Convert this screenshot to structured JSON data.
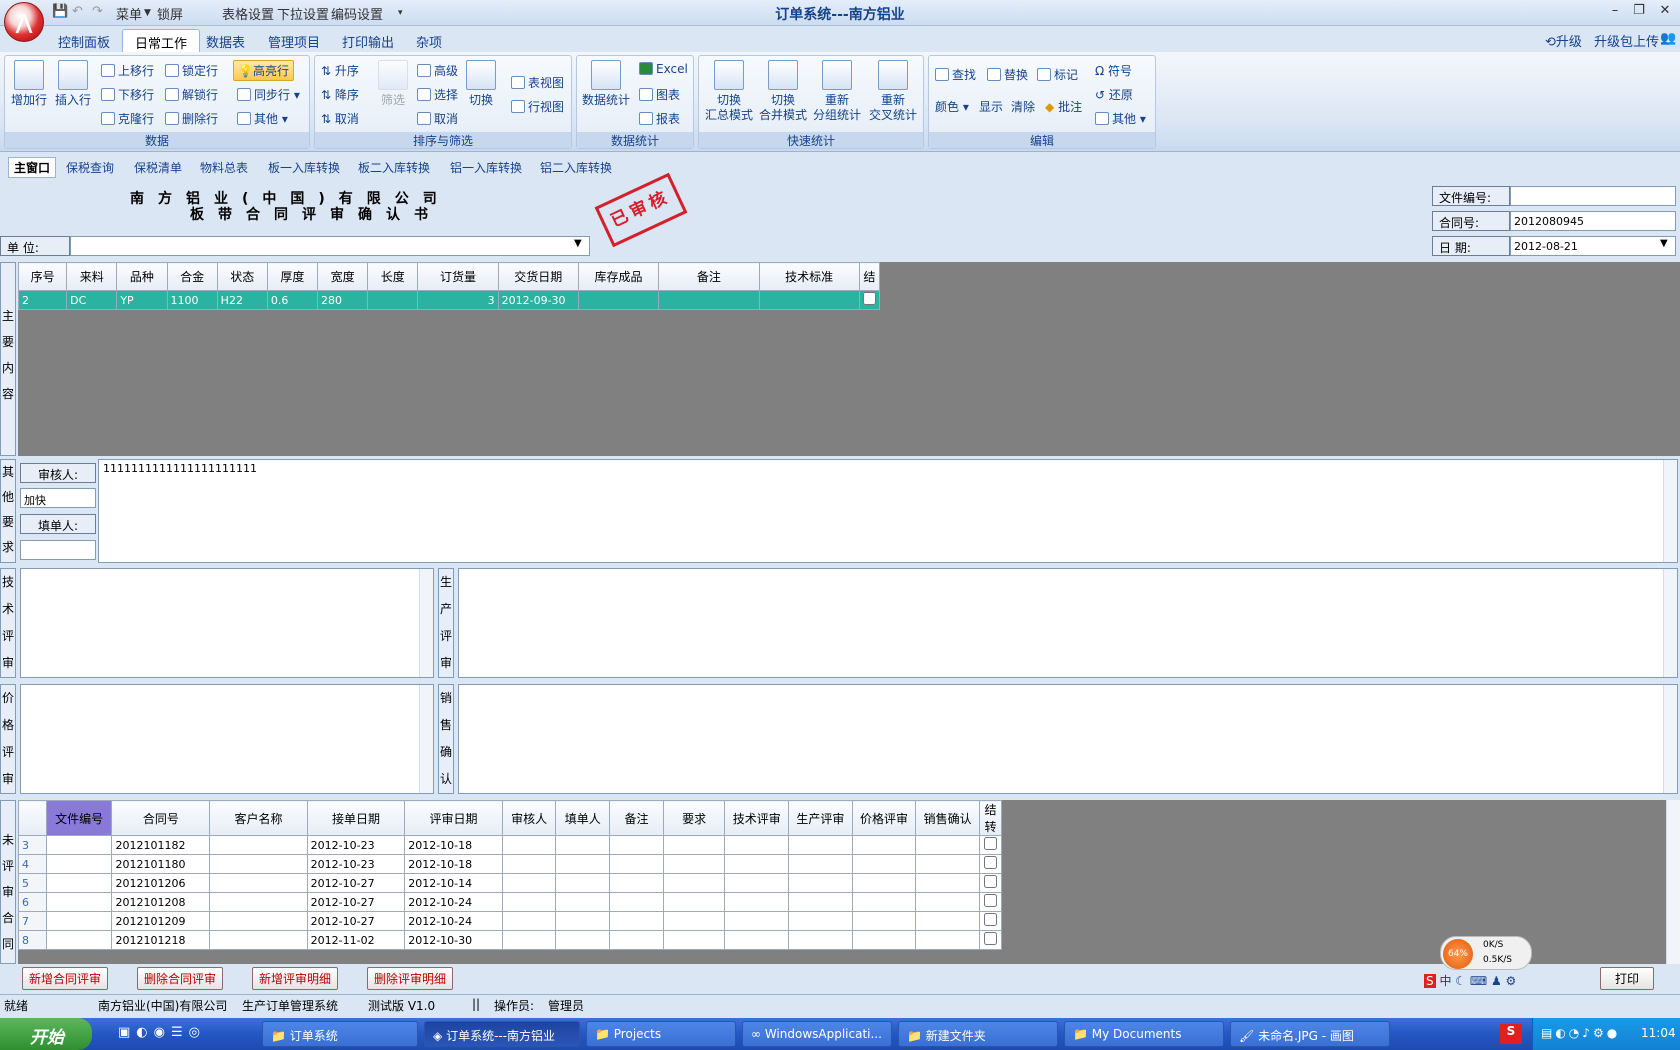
{
  "window": {
    "title": "订单系统---南方铝业",
    "min": "–",
    "max": "❐",
    "close": "✕"
  },
  "quickaccess": {
    "menu": "菜单",
    "lock": "锁屏",
    "table_settings": "表格设置",
    "dropdown_settings": "下拉设置",
    "encoding_settings": "编码设置"
  },
  "ribbon_tabs": [
    "控制面板",
    "日常工作",
    "数据表",
    "管理项目",
    "打印输出",
    "杂项"
  ],
  "upgrade": {
    "upgrade": "升级",
    "upload": "升级包上传"
  },
  "ribbon": {
    "data": {
      "label": "数据",
      "add_row": "增加行",
      "insert_row": "插入行",
      "move_up": "上移行",
      "move_down": "下移行",
      "clone": "克隆行",
      "lock_row": "锁定行",
      "unlock_row": "解锁行",
      "delete_row": "删除行",
      "highlight": "高亮行",
      "sync_row": "同步行",
      "other": "其他"
    },
    "sort": {
      "label": "排序与筛选",
      "asc": "升序",
      "desc": "降序",
      "cancel": "取消",
      "filter": "筛选",
      "advanced": "高级",
      "select": "选择",
      "cancel2": "取消",
      "switch": "切换",
      "table_view": "表视图",
      "row_view": "行视图"
    },
    "stats": {
      "label": "数据统计",
      "data_stats": "数据统计",
      "excel": "Excel",
      "chart": "图表",
      "report": "报表"
    },
    "quick": {
      "label": "快速统计",
      "b1a": "切换",
      "b1b": "汇总模式",
      "b2a": "切换",
      "b2b": "合并模式",
      "b3a": "重新",
      "b3b": "分组统计",
      "b4a": "重新",
      "b4b": "交叉统计"
    },
    "edit": {
      "label": "编辑",
      "find": "查找",
      "replace": "替换",
      "mark": "标记",
      "color": "颜色",
      "show": "显示",
      "clear": "清除",
      "annotate": "批注",
      "symbol": "符号",
      "restore": "还原",
      "other": "其他"
    }
  },
  "doc_tabs": [
    "主窗口",
    "保税查询",
    "保税清单",
    "物料总表",
    "板一入库转换",
    "板二入库转换",
    "铝一入库转换",
    "铝二入库转换"
  ],
  "form": {
    "company": "南方铝业(中国)有限公司",
    "doc_title": "板带合同评审确认书",
    "stamp": "已审核",
    "unit_label": "单  位:",
    "unit_value": "",
    "file_no_label": "文件编号:",
    "file_no": "",
    "contract_label": "合同号:",
    "contract_no": "2012080945",
    "date_label": "日  期:",
    "date": "2012-08-21"
  },
  "main_label": "主要内容",
  "main_headers": [
    "序号",
    "来料",
    "品种",
    "合金",
    "状态",
    "厚度",
    "宽度",
    "长度",
    "订货量",
    "交货日期",
    "库存成品",
    "备注",
    "技术标准",
    "结"
  ],
  "main_rows": [
    [
      "2",
      "DC",
      "YP",
      "1100",
      "H22",
      "0.6",
      "280",
      "",
      "3",
      "2012-09-30",
      "",
      "",
      "",
      ""
    ]
  ],
  "other": {
    "label": "其他要求",
    "reviewer_label": "审核人:",
    "reviewer": "加快",
    "filler_label": "填单人:",
    "filler": "",
    "text": "1111111111111111111111"
  },
  "tech_label": "技术评审",
  "prod_label": "生产评审",
  "price_label": "价格评审",
  "sales_label": "销售确认",
  "pending_label": "未评审合同",
  "pending_headers": [
    "文件编号",
    "合同号",
    "客户名称",
    "接单日期",
    "评审日期",
    "审核人",
    "填单人",
    "备注",
    "要求",
    "技术评审",
    "生产评审",
    "价格评审",
    "销售确认",
    "结转"
  ],
  "pending_rows": [
    [
      "3",
      "",
      "2012101182",
      "",
      "2012-10-23",
      "2012-10-18"
    ],
    [
      "4",
      "",
      "2012101180",
      "",
      "2012-10-23",
      "2012-10-18"
    ],
    [
      "5",
      "",
      "2012101206",
      "",
      "2012-10-27",
      "2012-10-14"
    ],
    [
      "6",
      "",
      "2012101208",
      "",
      "2012-10-27",
      "2012-10-24"
    ],
    [
      "7",
      "",
      "2012101209",
      "",
      "2012-10-27",
      "2012-10-24"
    ],
    [
      "8",
      "",
      "2012101218",
      "",
      "2012-11-02",
      "2012-10-30"
    ]
  ],
  "buttons": {
    "add_contract": "新增合同评审",
    "del_contract": "删除合同评审",
    "add_detail": "新增评审明细",
    "del_detail": "删除评审明细",
    "print": "打印"
  },
  "net": {
    "percent": "64%",
    "up": "0K/S",
    "down": "0.5K/S"
  },
  "status": {
    "ready": "就绪",
    "company": "南方铝业(中国)有限公司",
    "system": "生产订单管理系统",
    "version": "测试版 V1.0",
    "sep": "||",
    "operator_label": "操作员:",
    "operator": "管理员"
  },
  "taskbar": {
    "start": "开始",
    "tasks": [
      "订单系统",
      "订单系统---南方铝业",
      "Projects",
      "WindowsApplicati...",
      "新建文件夹",
      "My Documents",
      "未命名.JPG - 画图"
    ],
    "clock": "11:04"
  }
}
